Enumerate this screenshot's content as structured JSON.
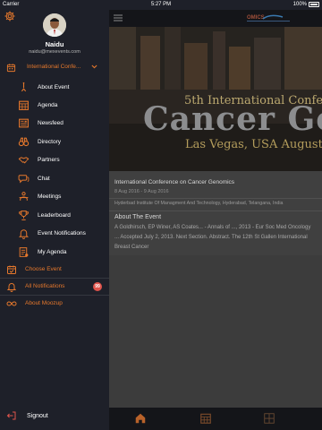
{
  "status_bar": {
    "carrier": "Carrier",
    "time": "5:27 PM",
    "battery": "100%"
  },
  "sidebar": {
    "profile": {
      "name": "Naidu",
      "email": "naidu@mexevents.com"
    },
    "current_event": "International Confe...",
    "menu_items": [
      {
        "label": "About Event",
        "icon": "info-icon"
      },
      {
        "label": "Agenda",
        "icon": "calendar-grid-icon"
      },
      {
        "label": "Newsfeed",
        "icon": "newspaper-icon"
      },
      {
        "label": "Directory",
        "icon": "binoculars-icon"
      },
      {
        "label": "Partners",
        "icon": "handshake-icon"
      },
      {
        "label": "Chat",
        "icon": "chat-bubble-icon"
      },
      {
        "label": "Meetings",
        "icon": "meetings-icon"
      },
      {
        "label": "Leaderboard",
        "icon": "trophy-icon"
      },
      {
        "label": "Event Notifications",
        "icon": "bell-icon"
      },
      {
        "label": "My Agenda",
        "icon": "my-agenda-icon"
      }
    ],
    "sections": [
      {
        "label": "Choose Event",
        "icon": "calendar-check-icon"
      },
      {
        "label": "All Notifications",
        "icon": "bell-icon",
        "badge": "99"
      },
      {
        "label": "About Moozup",
        "icon": "infinity-icon"
      }
    ],
    "signout": "Signout"
  },
  "main": {
    "logo_text": "OMICS",
    "banner": {
      "line1": "5th International Confe",
      "line2": "Cancer Gen",
      "line3": "Las Vegas, USA   August"
    },
    "event": {
      "title": "International Conference on Cancer Genomics",
      "dates": "8 Aug 2016 - 9 Aug 2016",
      "venue": "Hyderbad Institute Of Managment And Technology, Hyderabad, Telangana, India",
      "about_title": "About The Event",
      "about_text": "A Goldhirsch, EP Winer, AS Coates... - Annals of ..., 2013 - Eur Soc Med Oncology ... Accepted July 2, 2013. Next Section. Abstract. The 12th St Gallen International Breast Cancer"
    },
    "tabs": [
      "home-icon",
      "calendar-icon",
      "grid-icon"
    ]
  },
  "colors": {
    "accent": "#e6782c",
    "sidebar_bg": "#1e2029",
    "badge": "#e0544c"
  }
}
